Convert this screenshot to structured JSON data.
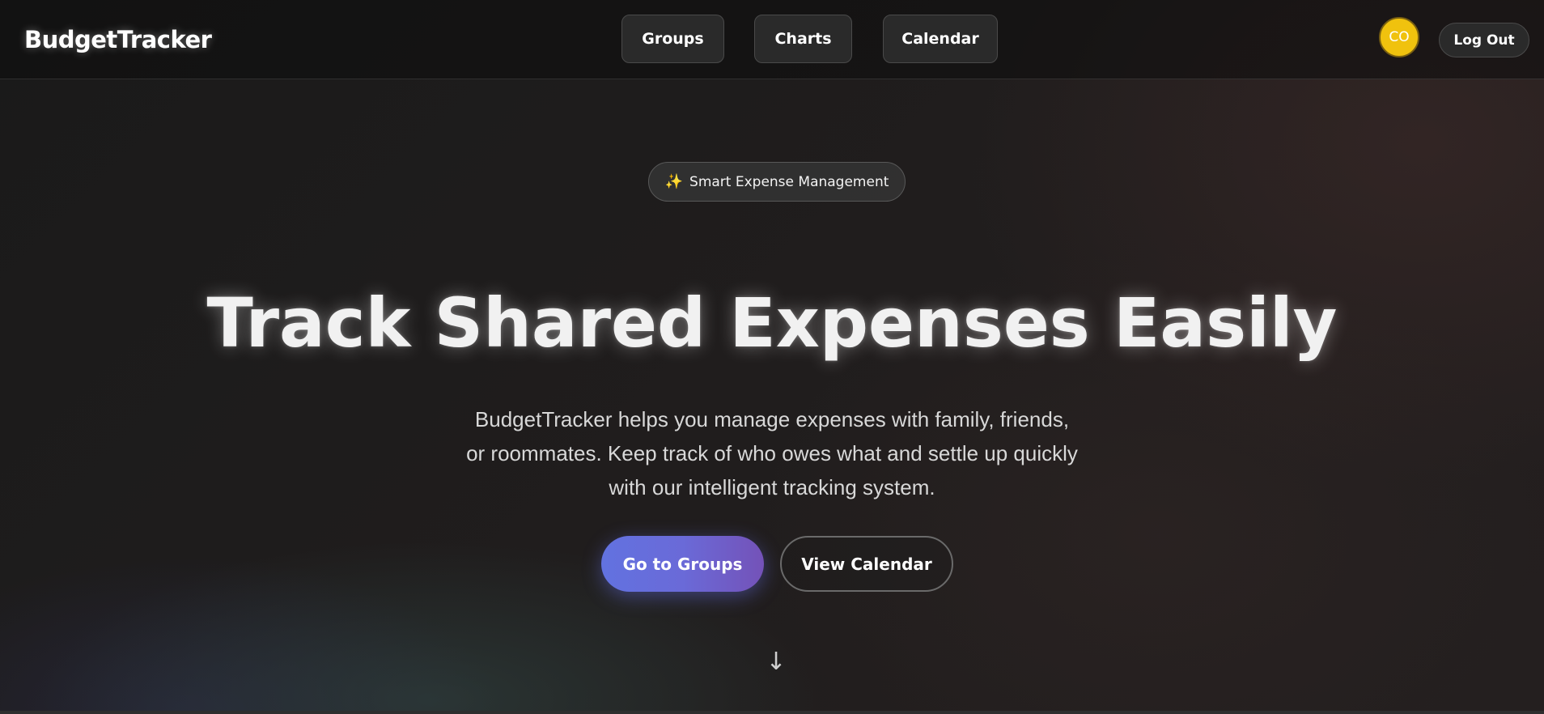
{
  "header": {
    "brand": "BudgetTracker",
    "nav": [
      {
        "label": "Groups"
      },
      {
        "label": "Charts"
      },
      {
        "label": "Calendar"
      }
    ],
    "avatar_initials": "CO",
    "avatar_color": "#f0c20e",
    "logout_label": "Log Out"
  },
  "hero": {
    "badge_icon": "sparkles-icon",
    "badge_text": "Smart Expense Management",
    "title": "Track Shared Expenses Easily",
    "subtitle": "BudgetTracker helps you manage expenses with family, friends, or roommates. Keep track of who owes what and settle up quickly with our intelligent tracking system.",
    "primary_cta": "Go to Groups",
    "secondary_cta": "View Calendar",
    "primary_cta_gradient": [
      "#6272e0",
      "#7452b8"
    ],
    "scroll_icon": "arrow-down-icon",
    "scroll_glyph": "↓"
  }
}
